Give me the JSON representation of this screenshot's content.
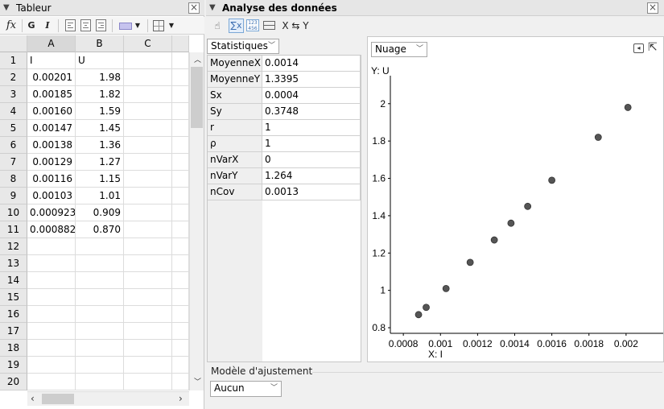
{
  "spreadsheet": {
    "title": "Tableur",
    "toolbar": {
      "fx": "fx",
      "bold": "G",
      "italic": "I"
    },
    "columns": [
      "A",
      "B",
      "C"
    ],
    "row_numbers": [
      "1",
      "2",
      "3",
      "4",
      "5",
      "6",
      "7",
      "8",
      "9",
      "10",
      "11",
      "12",
      "13",
      "14",
      "15",
      "16",
      "17",
      "18",
      "19",
      "20"
    ],
    "rows": [
      [
        "I",
        "U"
      ],
      [
        "0.00201",
        "1.98"
      ],
      [
        "0.00185",
        "1.82"
      ],
      [
        "0.00160",
        "1.59"
      ],
      [
        "0.00147",
        "1.45"
      ],
      [
        "0.00138",
        "1.36"
      ],
      [
        "0.00129",
        "1.27"
      ],
      [
        "0.00116",
        "1.15"
      ],
      [
        "0.00103",
        "1.01"
      ],
      [
        "0.000923",
        "0.909"
      ],
      [
        "0.000882",
        "0.870"
      ]
    ]
  },
  "analysis": {
    "title": "Analyse des données",
    "toolbar": {
      "swap_label": "X ⇆ Y"
    },
    "stats_selector": "Statistiques",
    "stats": [
      {
        "label": "MoyenneX",
        "value": "0.0014"
      },
      {
        "label": "MoyenneY",
        "value": "1.3395"
      },
      {
        "label": "Sx",
        "value": "0.0004"
      },
      {
        "label": "Sy",
        "value": "0.3748"
      },
      {
        "label": "r",
        "value": "1"
      },
      {
        "label": "ρ",
        "value": "1"
      },
      {
        "label": "nVarX",
        "value": "0"
      },
      {
        "label": "nVarY",
        "value": "1.264"
      },
      {
        "label": "nCov",
        "value": "0.0013"
      }
    ],
    "plot_selector": "Nuage",
    "fit_model_label": "Modèle d'ajustement",
    "fit_model_value": "Aucun"
  },
  "chart_data": {
    "type": "scatter",
    "xlabel": "X: I",
    "ylabel": "Y: U",
    "xlim": [
      0.00073,
      0.0022
    ],
    "ylim": [
      0.77,
      2.15
    ],
    "xticks": [
      0.0008,
      0.001,
      0.0012,
      0.0014,
      0.0016,
      0.0018,
      0.002
    ],
    "xtick_labels": [
      "0.0008",
      "0.001",
      "0.0012",
      "0.0014",
      "0.0016",
      "0.0018",
      "0.002"
    ],
    "yticks": [
      0.8,
      1,
      1.2,
      1.4,
      1.6,
      1.8,
      2
    ],
    "ytick_labels": [
      "0.8",
      "1",
      "1.2",
      "1.4",
      "1.6",
      "1.8",
      "2"
    ],
    "x": [
      0.00201,
      0.00185,
      0.0016,
      0.00147,
      0.00138,
      0.00129,
      0.00116,
      0.00103,
      0.000923,
      0.000882
    ],
    "y": [
      1.98,
      1.82,
      1.59,
      1.45,
      1.36,
      1.27,
      1.15,
      1.01,
      0.909,
      0.87
    ],
    "point_color": "#555555"
  }
}
